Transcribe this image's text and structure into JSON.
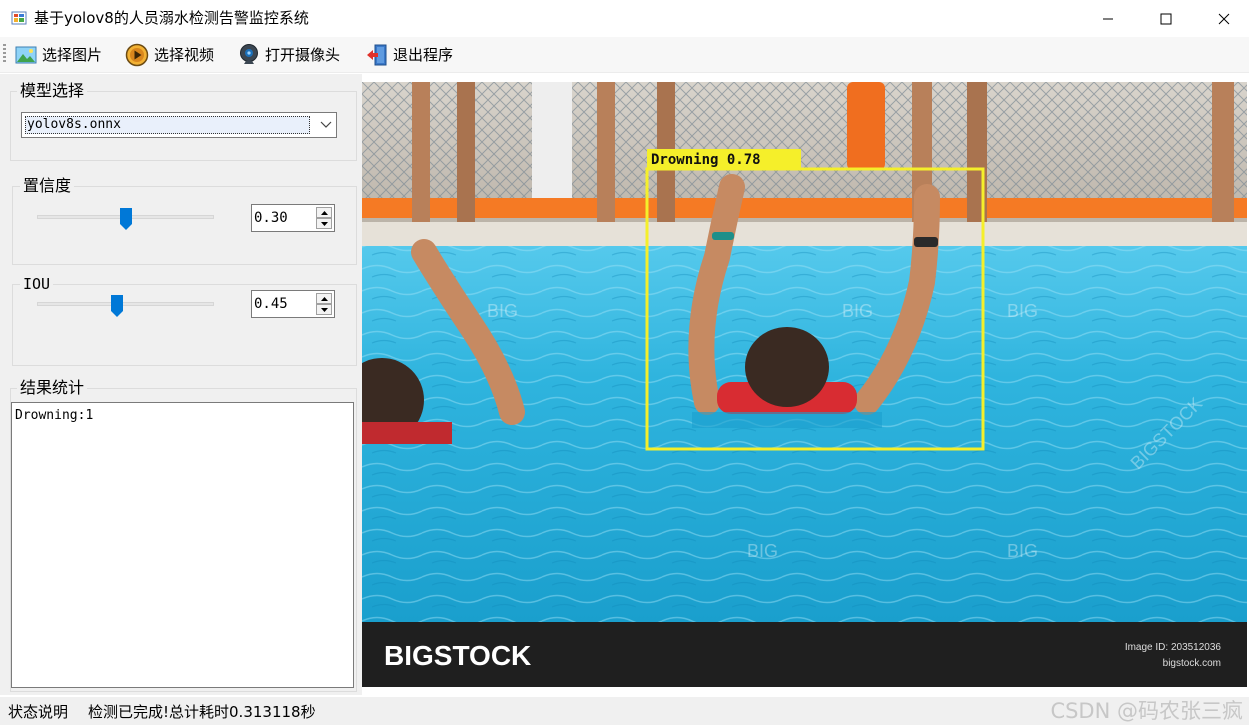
{
  "window": {
    "title": "基于yolov8的人员溺水检测告警监控系统",
    "minimize_icon": "minimize-icon",
    "maximize_icon": "maximize-icon",
    "close_icon": "close-icon"
  },
  "toolbar": {
    "items": [
      {
        "label": "选择图片",
        "icon": "picture-icon"
      },
      {
        "label": "选择视频",
        "icon": "play-icon"
      },
      {
        "label": "打开摄像头",
        "icon": "webcam-icon"
      },
      {
        "label": "退出程序",
        "icon": "exit-door-icon"
      }
    ]
  },
  "model_group": {
    "title": "模型选择",
    "selected": "yolov8s.onnx"
  },
  "confidence_group": {
    "title": "置信度",
    "value": "0.30",
    "slider_fraction": 0.5
  },
  "iou_group": {
    "title": "IOU",
    "value": "0.45",
    "slider_fraction": 0.45
  },
  "results_group": {
    "title": "结果统计",
    "text": "Drowning:1"
  },
  "image": {
    "detection_label": "Drowning 0.78",
    "detection_class": "Drowning",
    "detection_score": 0.78,
    "banner_brand": "BIGSTOCK",
    "banner_image_id": "Image ID: 203512036",
    "banner_site": "bigstock.com",
    "overlay_watermark": "BIG",
    "diagonal_watermark": "BIGSTOCK"
  },
  "statusbar": {
    "label": "状态说明",
    "message": "检测已完成!总计耗时0.313118秒",
    "watermark": "CSDN @码农张三疯"
  },
  "colors": {
    "accent": "#0078d7",
    "detection_box": "#f5ef2a",
    "pool_water": "#27b4dc"
  }
}
